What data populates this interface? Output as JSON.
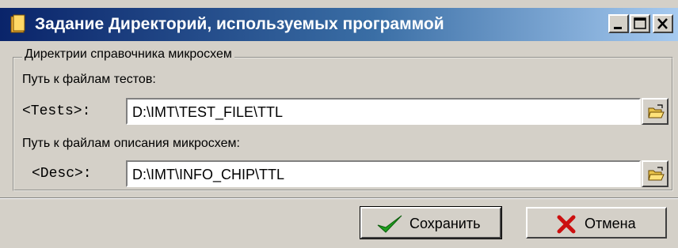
{
  "window": {
    "title": "Задание Директорий, используемых программой"
  },
  "group": {
    "title": "Директрии справочника микросхем",
    "tests": {
      "label": "Путь к файлам тестов:",
      "tag": "<Tests>:",
      "value": "D:\\IMT\\TEST_FILE\\TTL"
    },
    "desc": {
      "label": "Путь к файлам описания микросхем:",
      "tag": "<Desc>:",
      "value": "D:\\IMT\\INFO_CHIP\\TTL"
    }
  },
  "buttons": {
    "save_label": "Сохранить",
    "cancel_label": "Отмена"
  },
  "colors": {
    "titlebar_start": "#0a246a",
    "titlebar_end": "#a6caf0",
    "face": "#d4d0c8",
    "save_check": "#1e9e1e",
    "cancel_x": "#cc1010"
  }
}
